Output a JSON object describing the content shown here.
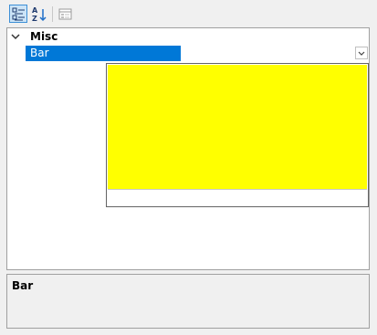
{
  "toolbar": {
    "categorized_icon": "categorized-icon",
    "alphabetical_icon": "alphabetical-sort-icon",
    "property_pages_icon": "property-pages-icon"
  },
  "grid": {
    "category": {
      "label": "Misc",
      "expanded": true
    },
    "property": {
      "name": "Bar",
      "value": "",
      "selected": true
    }
  },
  "dropdown": {
    "open": true,
    "color": "#ffff00",
    "footer_text": ""
  },
  "description": {
    "title": "Bar",
    "text": ""
  },
  "colors": {
    "selection": "#0078d7",
    "swatch": "#ffff00",
    "toolbar_active_bg": "#cce4f7",
    "toolbar_active_border": "#3d8fd6"
  }
}
